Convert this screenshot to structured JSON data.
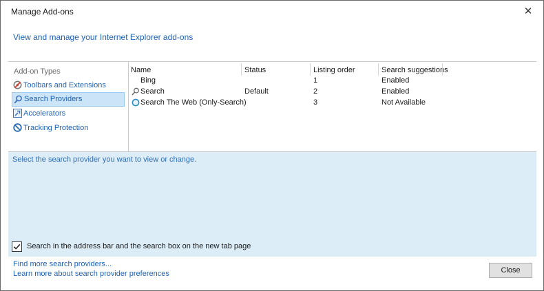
{
  "window": {
    "title": "Manage Add-ons",
    "close_glyph": "✕"
  },
  "header": {
    "link": "View and manage your Internet Explorer add-ons"
  },
  "sidebar": {
    "heading": "Add-on Types",
    "items": [
      {
        "label": "Toolbars and Extensions",
        "icon": "gear-block-icon",
        "selected": false
      },
      {
        "label": "Search Providers",
        "icon": "magnifier-icon",
        "selected": true
      },
      {
        "label": "Accelerators",
        "icon": "accelerator-icon",
        "selected": false
      },
      {
        "label": "Tracking Protection",
        "icon": "no-entry-icon",
        "selected": false
      }
    ]
  },
  "table": {
    "columns": [
      "Name",
      "Status",
      "Listing order",
      "Search suggestions"
    ],
    "rows": [
      {
        "name": "Bing",
        "status": "",
        "order": "1",
        "suggestions": "Enabled",
        "icon": "none"
      },
      {
        "name": "Search",
        "status": "Default",
        "order": "2",
        "suggestions": "Enabled",
        "icon": "magnifier-icon"
      },
      {
        "name": "Search The Web (Only-Search)",
        "status": "",
        "order": "3",
        "suggestions": "Not Available",
        "icon": "circle-icon"
      }
    ]
  },
  "details": {
    "hint": "Select the search provider you want to view or change.",
    "checkbox_label": "Search in the address bar and the search box on the new tab page",
    "checkbox_checked": true,
    "checkbox_glyph": "✓"
  },
  "footer": {
    "link_find": "Find more search providers...",
    "link_learn": "Learn more about search provider preferences",
    "close_button": "Close"
  },
  "colors": {
    "link": "#1e63b4",
    "selection": "#cce4f7",
    "details_bg": "#dcedf8"
  }
}
